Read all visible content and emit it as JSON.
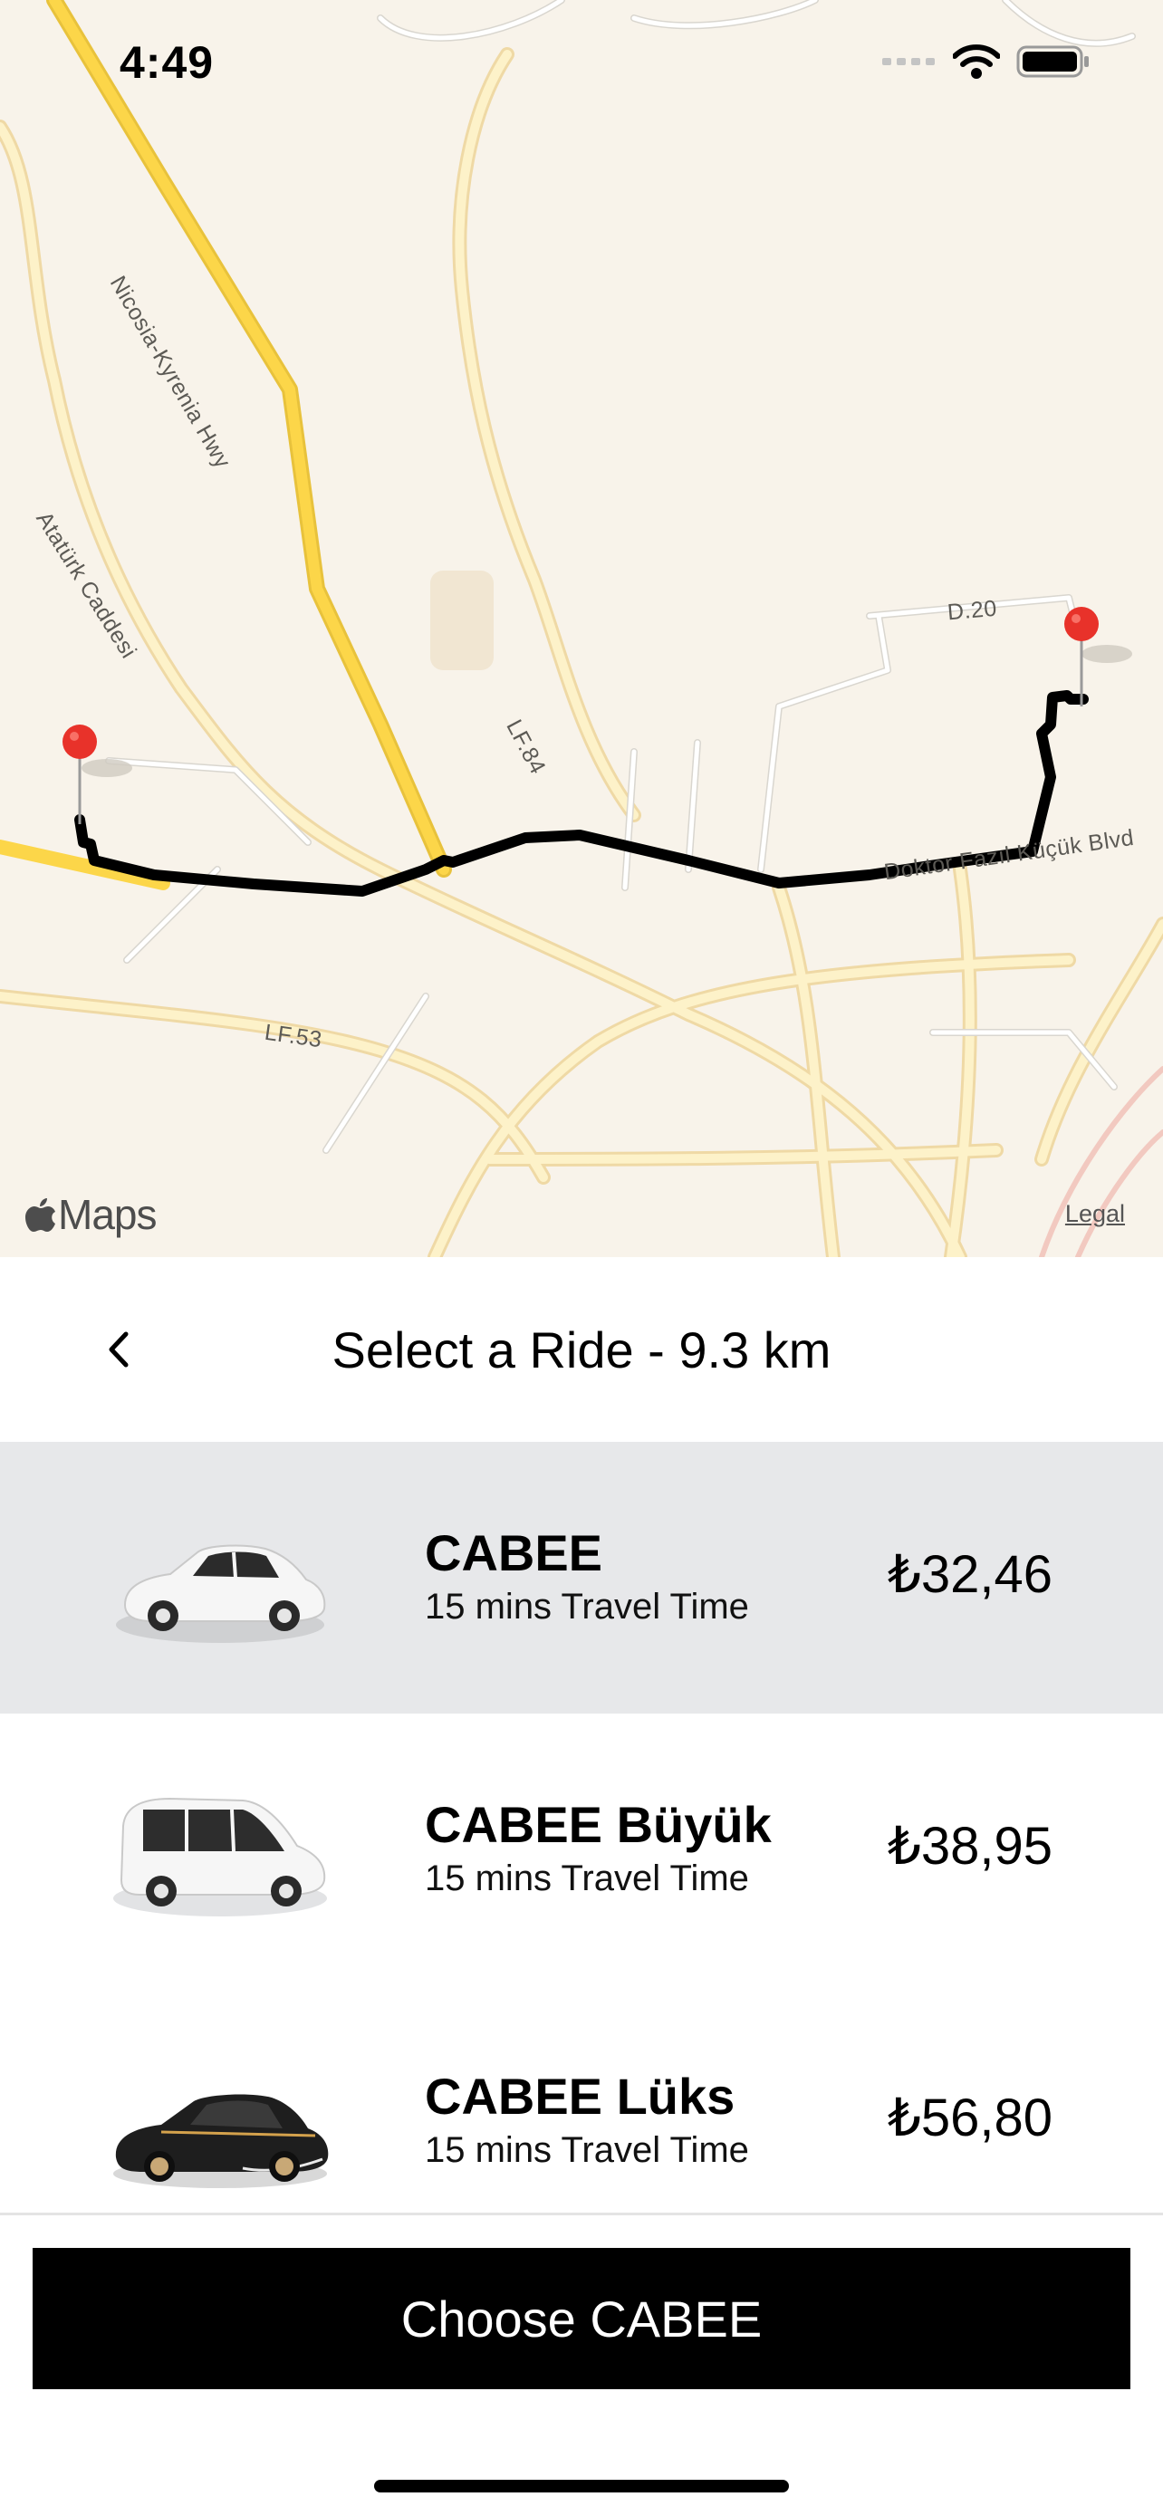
{
  "status_bar": {
    "time": "4:49"
  },
  "map": {
    "labels": {
      "highway": "Nicosia-Kyrenia Hwy",
      "ataturk": "Atatürk Caddesi",
      "lf84": "LF.84",
      "d20": "D.20",
      "lf53": "LF.53",
      "kucuk": "Doktor Fazıl Küçük Blvd"
    },
    "attribution": "Maps",
    "legal": "Legal",
    "route_color": "#000000",
    "pin_color": "#e8322a"
  },
  "sheet": {
    "title": "Select a Ride - 9.3 km",
    "rides": [
      {
        "name": "CABEE",
        "time": "15 mins Travel Time",
        "price": "₺32,46",
        "car": "white-sedan-icon",
        "selected": true
      },
      {
        "name": "CABEE Büyük",
        "time": "15 mins Travel Time",
        "price": "₺38,95",
        "car": "white-van-icon",
        "selected": false
      },
      {
        "name": "CABEE Lüks",
        "time": "15 mins Travel Time",
        "price": "₺56,80",
        "car": "black-luxury-sedan-icon",
        "selected": false
      }
    ],
    "choose_button": "Choose CABEE"
  }
}
